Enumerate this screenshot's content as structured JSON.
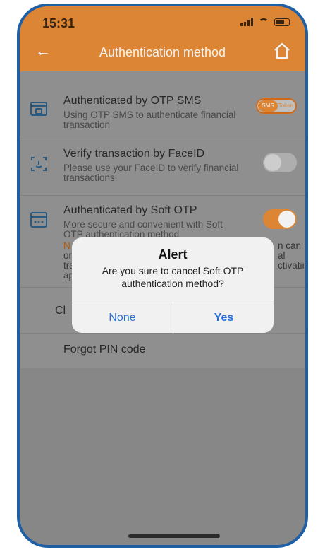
{
  "status_bar": {
    "time": "15:31"
  },
  "header": {
    "title": "Authentication method"
  },
  "items": [
    {
      "title": "Authenticated by OTP SMS",
      "subtitle_line1": "Using OTP SMS to authenticate financial",
      "subtitle_line2": "transaction",
      "segmented": {
        "left": "SMS",
        "right": "Token"
      }
    },
    {
      "title": "Verify transaction by FaceID",
      "subtitle_line1": " Please use your FaceID to verify financial",
      "subtitle_line2": "transactions",
      "toggle_state": "off"
    },
    {
      "title": "Authenticated by Soft OTP",
      "subtitle_line1": "More secure and convenient with Soft",
      "subtitle_line2": "OTP authentication method",
      "toggle_state": "on"
    }
  ],
  "partial_rows": {
    "note_left": "N",
    "note_left2": "or",
    "note_left3": "tra",
    "note_left4": "ap",
    "note_right1": "n can",
    "note_right2": "al",
    "note_right3": "ctivating"
  },
  "change_row": {
    "label_left": "Cl"
  },
  "forgot": {
    "label": "Forgot PIN code"
  },
  "alert": {
    "title": "Alert",
    "message": "Are you sure to cancel Soft OTP authentication method?",
    "button_none": "None",
    "button_yes": "Yes"
  }
}
